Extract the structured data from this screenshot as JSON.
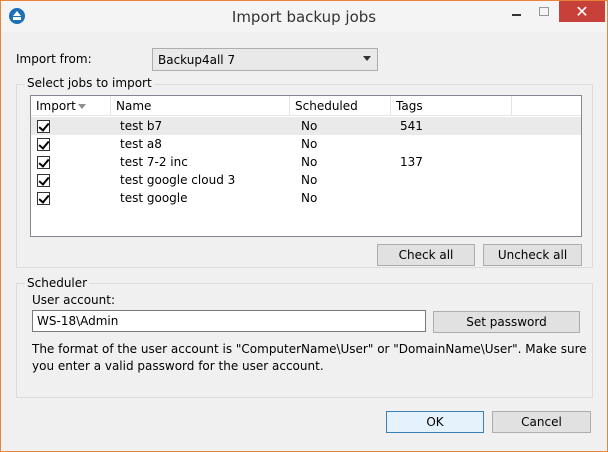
{
  "window": {
    "title": "Import backup jobs",
    "close_glyph": "✕"
  },
  "import_from": {
    "label": "Import from:",
    "selected": "Backup4all 7"
  },
  "jobs_group": {
    "title": "Select jobs to import"
  },
  "jobs_list": {
    "columns": [
      "Import",
      "Name",
      "Scheduled",
      "Tags"
    ],
    "rows": [
      {
        "checked": true,
        "name": "test b7",
        "scheduled": "No",
        "tags": "541"
      },
      {
        "checked": true,
        "name": "test a8",
        "scheduled": "No",
        "tags": ""
      },
      {
        "checked": true,
        "name": "test 7-2 inc",
        "scheduled": "No",
        "tags": "137"
      },
      {
        "checked": true,
        "name": "test google cloud 3",
        "scheduled": "No",
        "tags": ""
      },
      {
        "checked": true,
        "name": "test google",
        "scheduled": "No",
        "tags": ""
      }
    ]
  },
  "buttons": {
    "check_all": "Check all",
    "uncheck_all": "Uncheck all",
    "set_password": "Set password",
    "ok": "OK",
    "cancel": "Cancel"
  },
  "scheduler": {
    "title": "Scheduler",
    "user_account_label": "User account:",
    "user_account_value": "WS-18\\Admin",
    "info_text": "The format of the user account is \"ComputerName\\User\" or \"DomainName\\User\". Make sure you enter a valid password for the user account."
  },
  "colors": {
    "window_border": "#e8833a",
    "close_button": "#c7413a",
    "app_icon": "#1d6fb8"
  }
}
